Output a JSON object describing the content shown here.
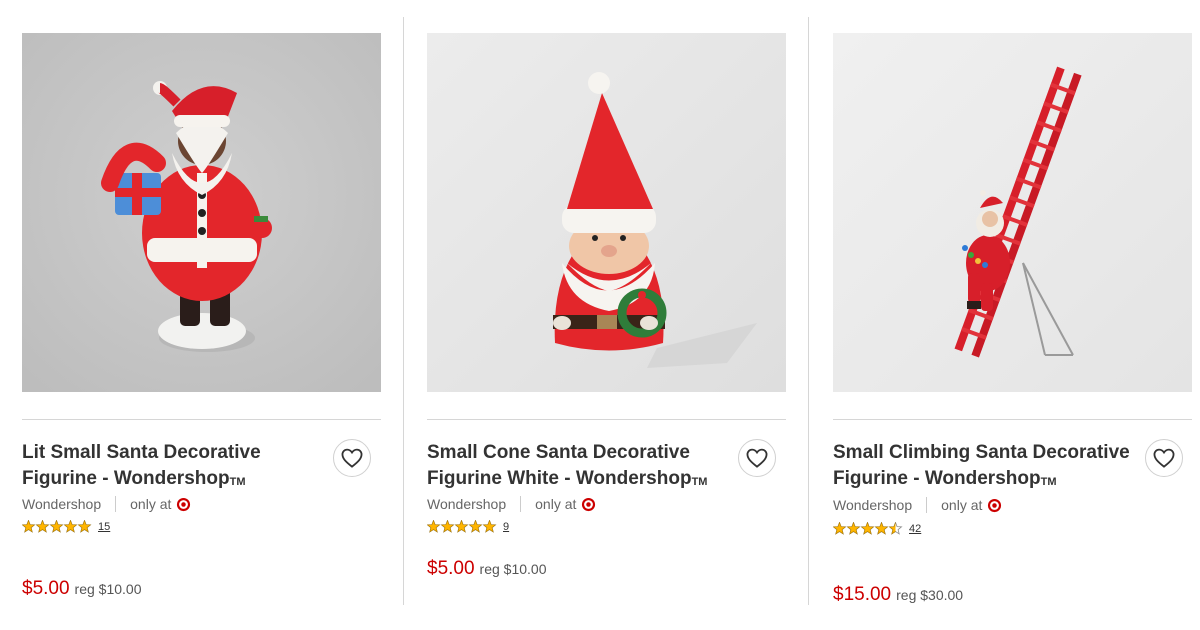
{
  "products": [
    {
      "title": "Lit Small Santa Decorative Figurine - Wondershop",
      "trademark": "TM",
      "brand": "Wondershop",
      "availability": "only at",
      "rating": 5,
      "review_count": "15",
      "sale_price": "$5.00",
      "regular_price": "reg $10.00"
    },
    {
      "title": "Small Cone Santa Decorative Figurine White - Wondershop",
      "trademark": "TM",
      "brand": "Wondershop",
      "availability": "only at",
      "rating": 5,
      "review_count": "9",
      "sale_price": "$5.00",
      "regular_price": "reg $10.00"
    },
    {
      "title": "Small Climbing Santa Decorative Figurine - Wondershop",
      "trademark": "TM",
      "brand": "Wondershop",
      "availability": "only at",
      "rating": 4.5,
      "review_count": "42",
      "sale_price": "$15.00",
      "regular_price": "reg $30.00"
    }
  ],
  "icons": {
    "favorite": "heart-icon",
    "retailer": "target-bullseye-icon",
    "rating": "star-icon"
  },
  "colors": {
    "sale_price": "#cc0000",
    "star": "#ffb500",
    "target_red": "#cc0000"
  }
}
